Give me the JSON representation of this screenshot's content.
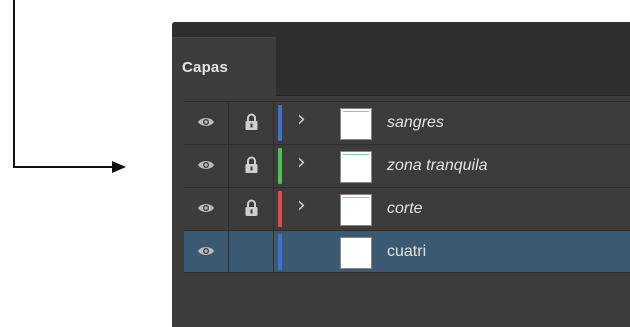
{
  "panel": {
    "tab_label": "Capas"
  },
  "layers": [
    {
      "name": "sangres",
      "color": "#3f6fd1",
      "expandable": true,
      "locked": true,
      "selected": false,
      "italic": true,
      "thumb_accent": "#8fbad0"
    },
    {
      "name": "zona tranquila",
      "color": "#4ec24e",
      "expandable": true,
      "locked": true,
      "selected": false,
      "italic": true,
      "thumb_accent": "#8fd0a2"
    },
    {
      "name": "corte",
      "color": "#e24b4b",
      "expandable": true,
      "locked": true,
      "selected": false,
      "italic": true,
      "thumb_accent": "#e2a0a0"
    },
    {
      "name": "cuatri",
      "color": "#3f6fd1",
      "expandable": false,
      "locked": false,
      "selected": true,
      "italic": false,
      "thumb_accent": "#ffffff"
    }
  ],
  "icons": {
    "visibility": "eye-icon",
    "lock": "lock-icon",
    "expand": "chevron-right-icon"
  }
}
